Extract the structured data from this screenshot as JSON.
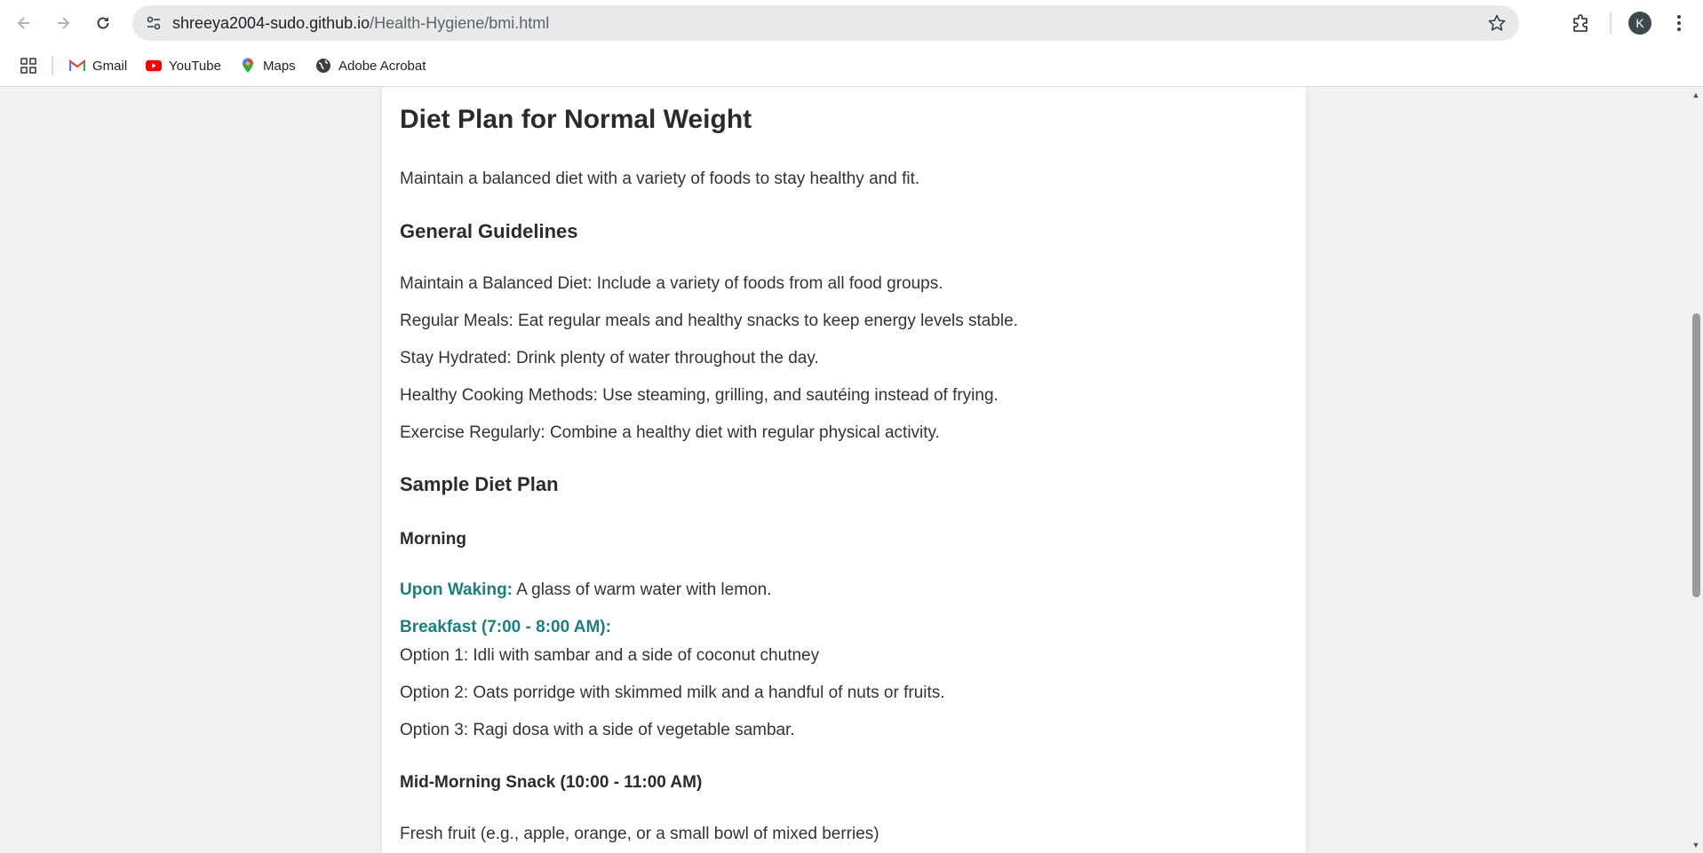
{
  "browser": {
    "url_host": "shreeya2004-sudo.github.io",
    "url_path": "/Health-Hygiene/bmi.html",
    "avatar_letter": "K"
  },
  "bookmarks": [
    {
      "label": "Gmail",
      "icon": "gmail-icon"
    },
    {
      "label": "YouTube",
      "icon": "youtube-icon"
    },
    {
      "label": "Maps",
      "icon": "maps-icon"
    },
    {
      "label": "Adobe Acrobat",
      "icon": "globe-icon"
    }
  ],
  "page": {
    "title": "Diet Plan for Normal Weight",
    "intro": "Maintain a balanced diet with a variety of foods to stay healthy and fit.",
    "guidelines_heading": "General Guidelines",
    "guidelines": [
      "Maintain a Balanced Diet: Include a variety of foods from all food groups.",
      "Regular Meals: Eat regular meals and healthy snacks to keep energy levels stable.",
      "Stay Hydrated: Drink plenty of water throughout the day.",
      "Healthy Cooking Methods: Use steaming, grilling, and sautéing instead of frying.",
      "Exercise Regularly: Combine a healthy diet with regular physical activity."
    ],
    "sample_heading": "Sample Diet Plan",
    "morning_heading": "Morning",
    "waking_label": "Upon Waking:",
    "waking_text": " A glass of warm water with lemon.",
    "breakfast_label": "Breakfast (7:00 - 8:00 AM):",
    "breakfast_options": [
      "Option 1: Idli with sambar and a side of coconut chutney",
      "Option 2: Oats porridge with skimmed milk and a handful of nuts or fruits.",
      "Option 3: Ragi dosa with a side of vegetable sambar."
    ],
    "snack_heading": "Mid-Morning Snack (10:00 - 11:00 AM)",
    "snack_text": "Fresh fruit (e.g., apple, orange, or a small bowl of mixed berries)"
  },
  "colors": {
    "accent_teal": "#1a7f80"
  }
}
